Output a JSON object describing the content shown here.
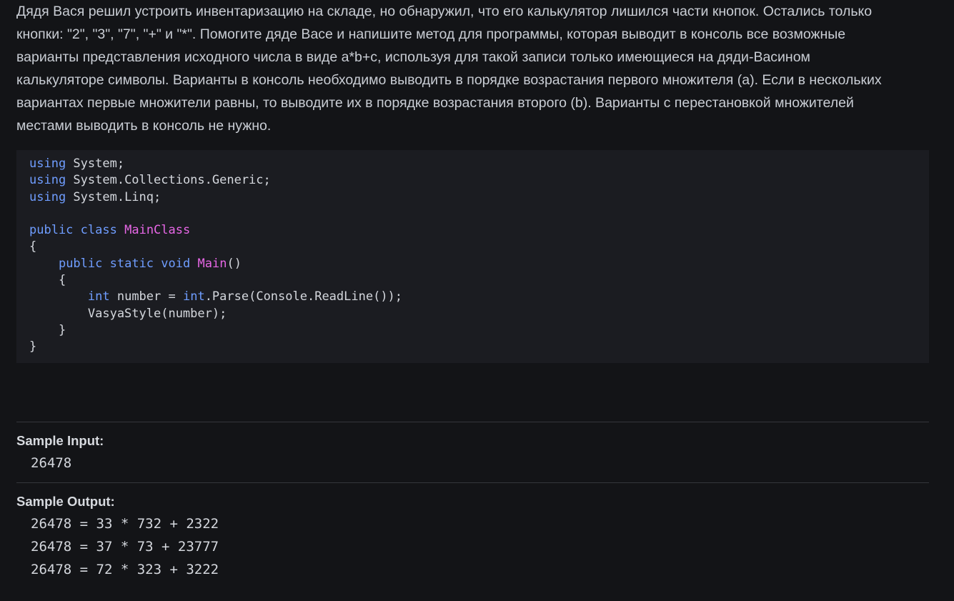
{
  "problem": {
    "statement_lines": [
      "Дядя Вася решил устроить инвентаризацию на складе, но обнаружил, что его калькулятор лишился части кнопок. Остались только",
      "кнопки: \"2\", \"3\", \"7\", \"+\" и \"*\". Помогите дяде Васе и напишите метод для программы, которая выводит в консоль все возможные",
      "варианты представления исходного числа в виде a*b+c, используя для такой записи только имеющиеся на дяди-Васином",
      "калькуляторе символы. Варианты в консоль необходимо выводить в порядке возрастания первого множителя (a). Если в нескольких",
      "вариантах первые множители равны, то выводите их в порядке возрастания второго (b). Варианты с перестановкой множителей",
      "местами выводить в консоль не нужно."
    ]
  },
  "code": {
    "language": "csharp",
    "lines": [
      [
        {
          "t": "using",
          "c": "kw"
        },
        {
          "t": " System;",
          "c": "plain"
        }
      ],
      [
        {
          "t": "using",
          "c": "kw"
        },
        {
          "t": " System.Collections.Generic;",
          "c": "plain"
        }
      ],
      [
        {
          "t": "using",
          "c": "kw"
        },
        {
          "t": " System.Linq;",
          "c": "plain"
        }
      ],
      [],
      [
        {
          "t": "public",
          "c": "kw"
        },
        {
          "t": " ",
          "c": "plain"
        },
        {
          "t": "class",
          "c": "kw"
        },
        {
          "t": " ",
          "c": "plain"
        },
        {
          "t": "MainClass",
          "c": "name"
        }
      ],
      [
        {
          "t": "{",
          "c": "plain"
        }
      ],
      [
        {
          "t": "    ",
          "c": "plain"
        },
        {
          "t": "public",
          "c": "kw"
        },
        {
          "t": " ",
          "c": "plain"
        },
        {
          "t": "static",
          "c": "kw"
        },
        {
          "t": " ",
          "c": "plain"
        },
        {
          "t": "void",
          "c": "kw"
        },
        {
          "t": " ",
          "c": "plain"
        },
        {
          "t": "Main",
          "c": "name"
        },
        {
          "t": "()",
          "c": "plain"
        }
      ],
      [
        {
          "t": "    {",
          "c": "plain"
        }
      ],
      [
        {
          "t": "        ",
          "c": "plain"
        },
        {
          "t": "int",
          "c": "type"
        },
        {
          "t": " number = ",
          "c": "plain"
        },
        {
          "t": "int",
          "c": "type"
        },
        {
          "t": ".Parse(Console.ReadLine());",
          "c": "plain"
        }
      ],
      [
        {
          "t": "        VasyaStyle(number);",
          "c": "plain"
        }
      ],
      [
        {
          "t": "    }",
          "c": "plain"
        }
      ],
      [
        {
          "t": "}",
          "c": "plain"
        }
      ]
    ]
  },
  "sample_input": {
    "label": "Sample Input:",
    "lines": [
      "26478"
    ]
  },
  "sample_output": {
    "label": "Sample Output:",
    "lines": [
      "26478 = 33 * 732 + 2322",
      "26478 = 37 * 73 + 23777",
      "26478 = 72 * 323 + 3222"
    ]
  },
  "colors": {
    "background": "#131417",
    "code_background": "#1b1c21",
    "keyword": "#6f9dff",
    "identifier": "#e767e6",
    "text": "#c9cdd4"
  }
}
